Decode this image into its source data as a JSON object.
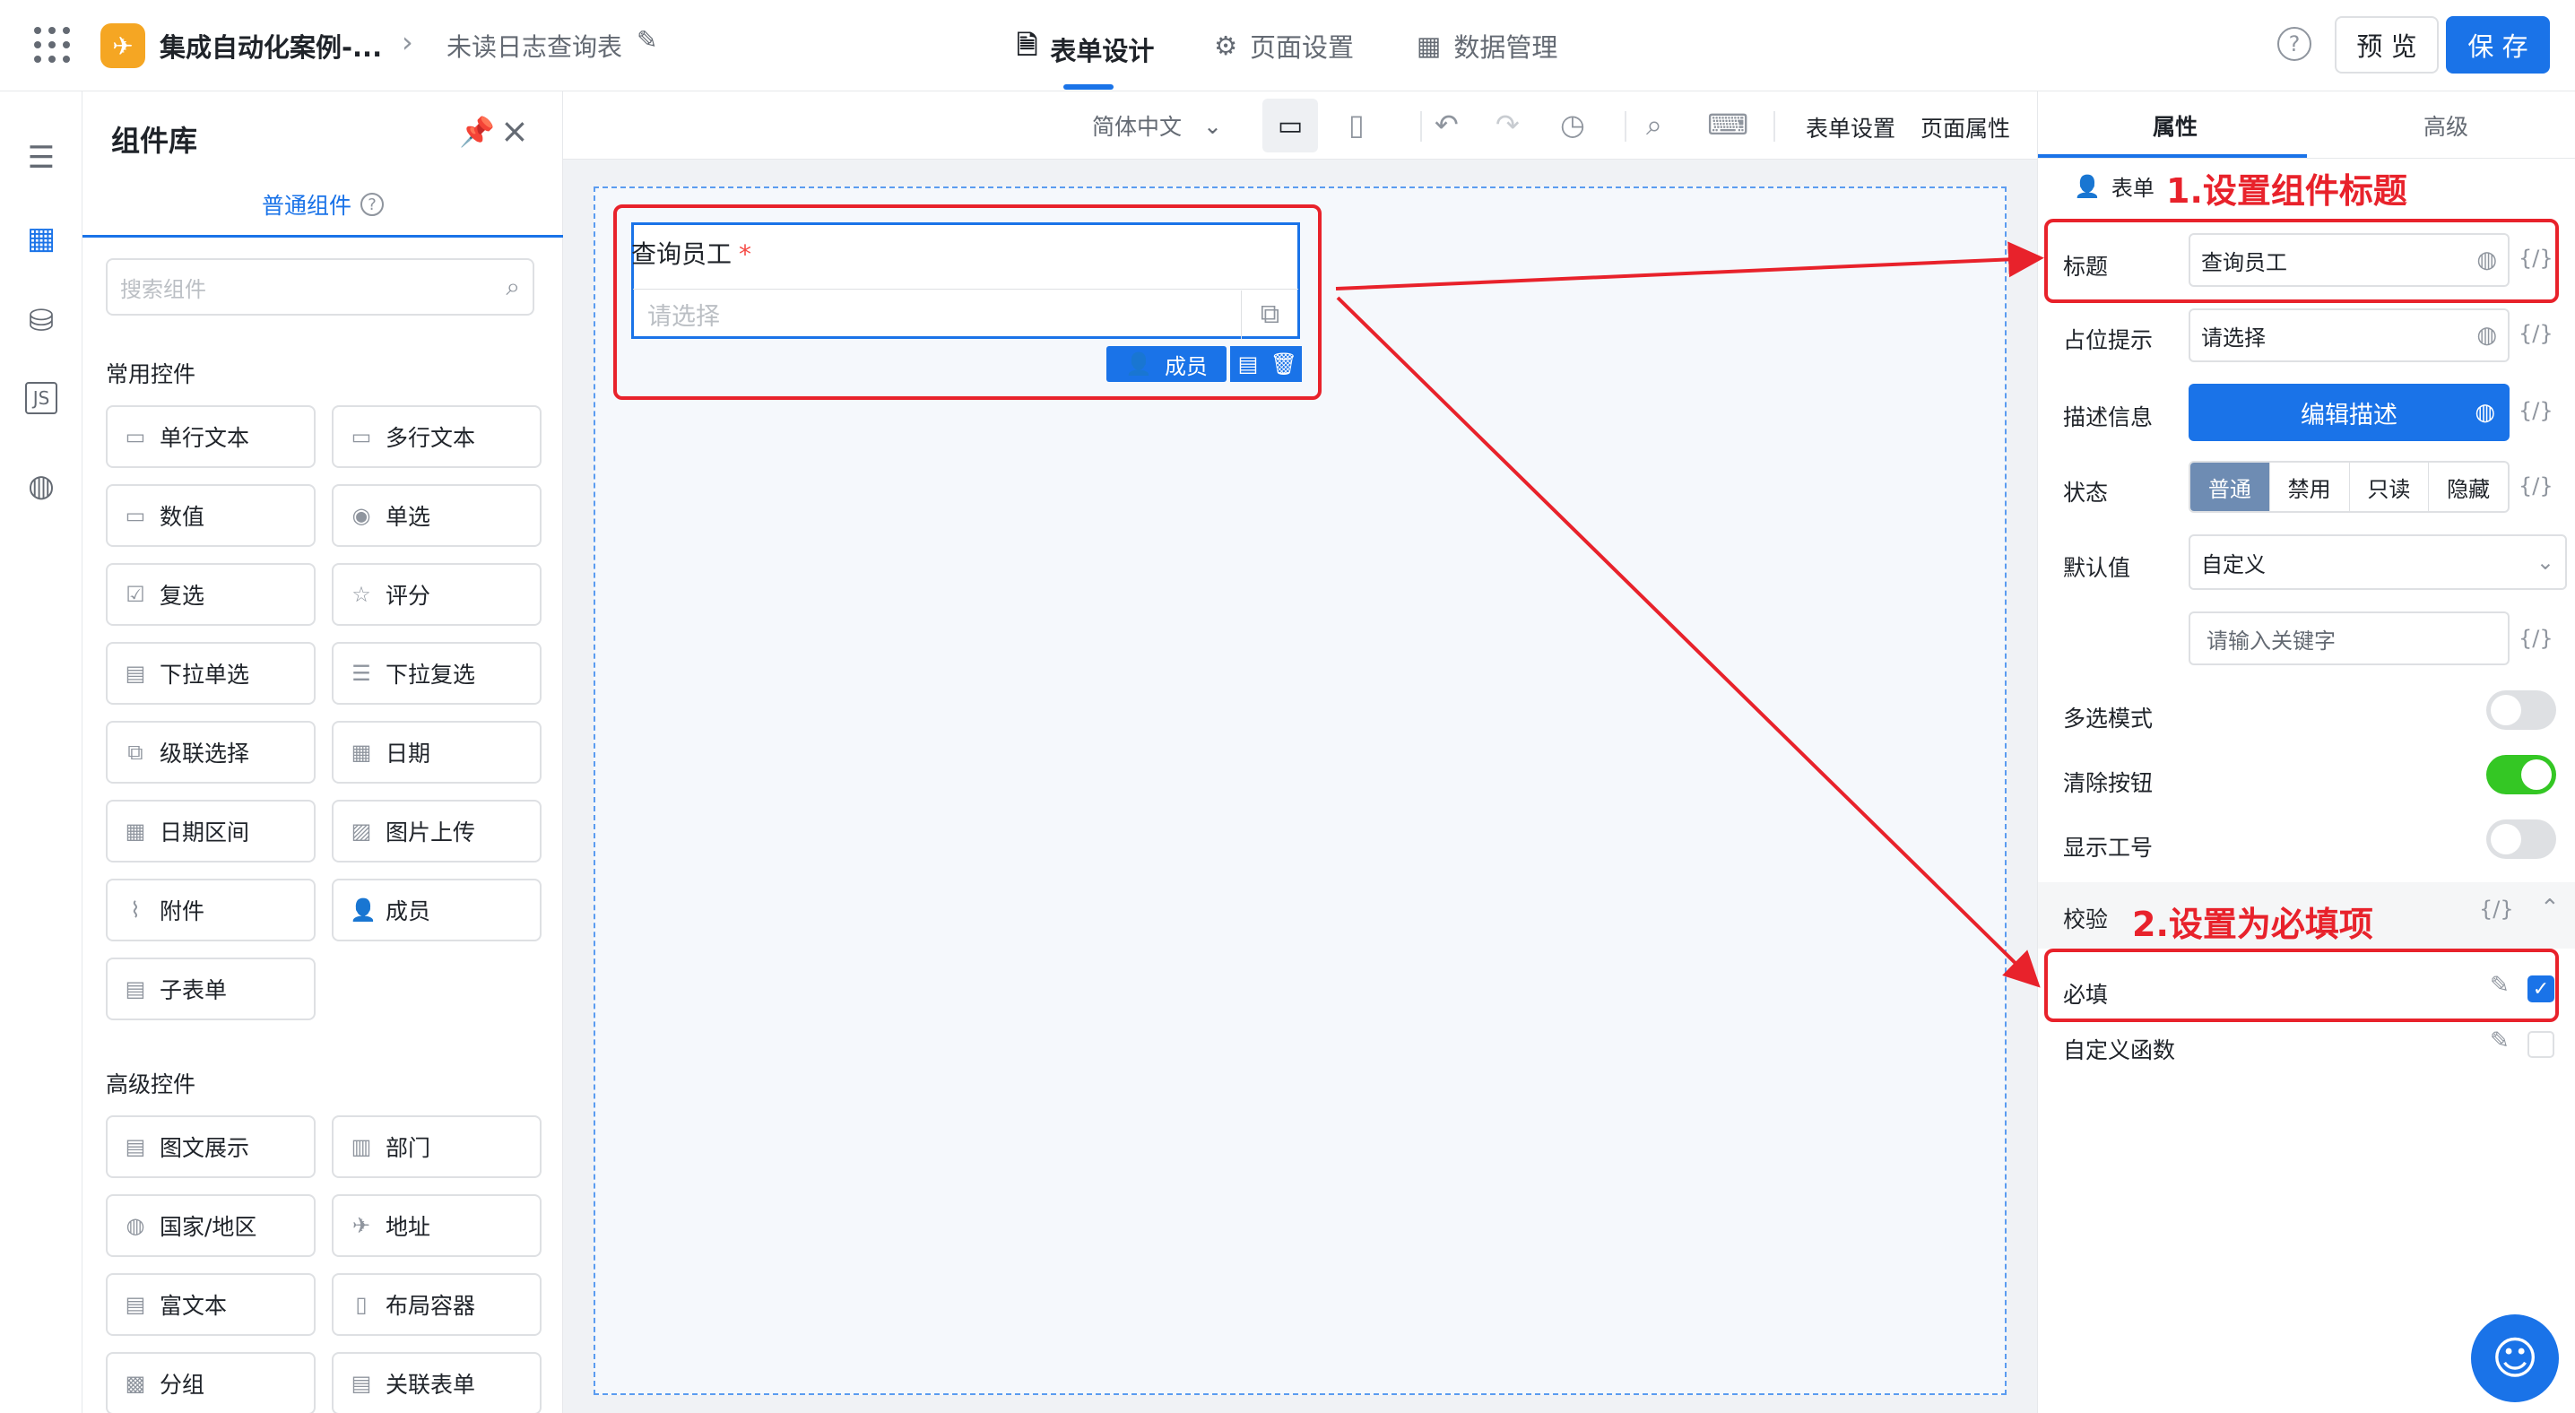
{
  "header": {
    "app_name": "集成自动化案例-...",
    "crumb": "未读日志查询表",
    "tabs": [
      "表单设计",
      "页面设置",
      "数据管理"
    ],
    "preview_label": "预 览",
    "save_label": "保 存",
    "help": "?"
  },
  "library": {
    "title": "组件库",
    "tab": "普通组件",
    "search_placeholder": "搜索组件",
    "common_title": "常用控件",
    "common": [
      "单行文本",
      "多行文本",
      "数值",
      "单选",
      "复选",
      "评分",
      "下拉单选",
      "下拉复选",
      "级联选择",
      "日期",
      "日期区间",
      "图片上传",
      "附件",
      "成员",
      "子表单"
    ],
    "advanced_title": "高级控件",
    "advanced": [
      "图文展示",
      "部门",
      "国家/地区",
      "地址",
      "富文本",
      "布局容器",
      "分组",
      "关联表单"
    ]
  },
  "toolbar": {
    "language": "简体中文",
    "form_settings": "表单设置",
    "page_props": "页面属性"
  },
  "canvas": {
    "field_label": "查询员工",
    "required_mark": "*",
    "placeholder": "请选择",
    "chip_label": "成员"
  },
  "panel": {
    "tabs": [
      "属性",
      "高级"
    ],
    "form_label": "表单",
    "title_label": "标题",
    "title_value": "查询员工",
    "placeholder_label": "占位提示",
    "placeholder_value": "请选择",
    "desc_label": "描述信息",
    "desc_button": "编辑描述",
    "state_label": "状态",
    "states": [
      "普通",
      "禁用",
      "只读",
      "隐藏"
    ],
    "default_label": "默认值",
    "default_value": "自定义",
    "keyword_placeholder": "请输入关键字",
    "code_icon": "{/}",
    "multi_label": "多选模式",
    "multi_on": false,
    "clear_label": "清除按钮",
    "clear_on": true,
    "jobno_label": "显示工号",
    "jobno_on": false,
    "validate_label": "校验",
    "required_label": "必填",
    "required_checked": true,
    "custom_fn_label": "自定义函数",
    "custom_fn_checked": false
  },
  "annotations": {
    "step1": "1.设置组件标题",
    "step2": "2.设置为必填项"
  },
  "colors": {
    "accent": "#1a73e8",
    "annotation": "#e8222b",
    "toggle_on": "#34c724"
  }
}
